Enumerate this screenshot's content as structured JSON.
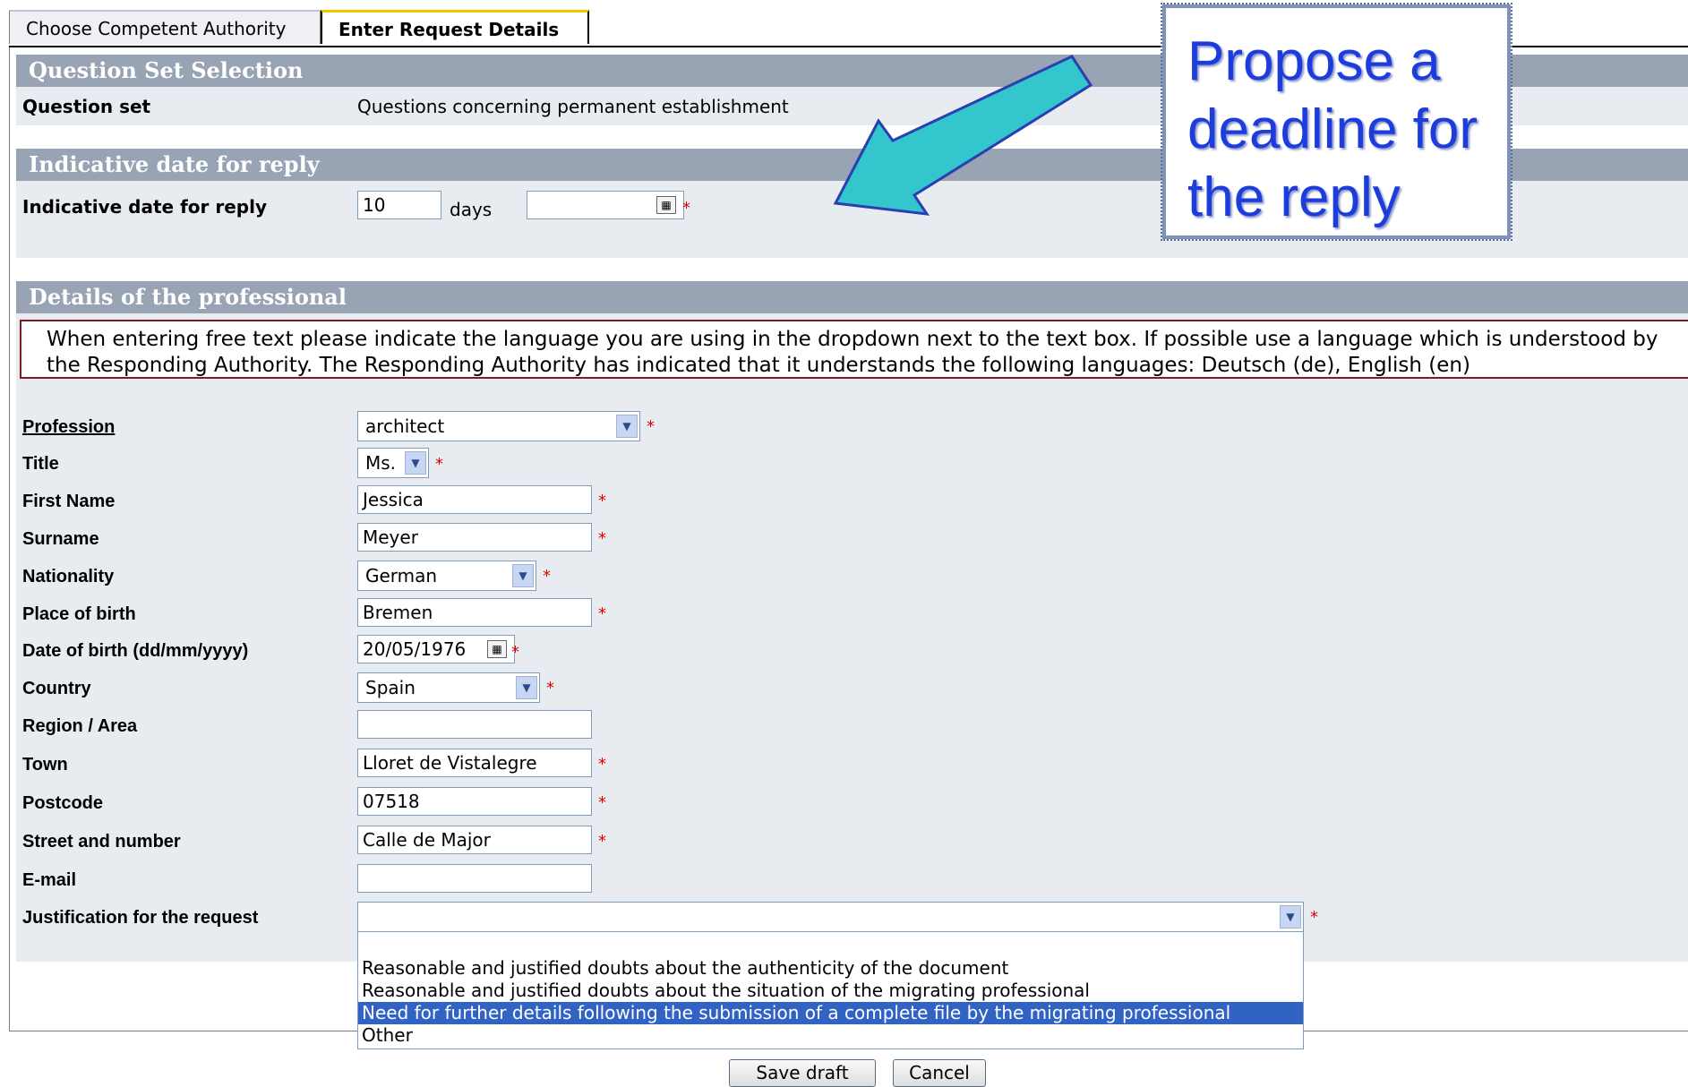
{
  "tabs": [
    {
      "label": "Choose Competent Authority",
      "active": false
    },
    {
      "label": "Enter Request Details",
      "active": true
    }
  ],
  "sections": {
    "question_set": {
      "title": "Question Set Selection",
      "label": "Question set",
      "value": "Questions concerning permanent establishment"
    },
    "indicative": {
      "title": "Indicative date for reply",
      "label": "Indicative date for reply",
      "days_value": "10",
      "days_unit": "days",
      "date_value": ""
    },
    "professional": {
      "title": "Details of the professional",
      "notice": "When entering free text please indicate the language you are using in the dropdown next to the text box. If possible use a language which is understood by the Responding Authority. The Responding Authority has indicated that it understands the following languages: Deutsch (de), English (en)"
    }
  },
  "form": {
    "profession": {
      "label": "Profession ",
      "value": "architect"
    },
    "title": {
      "label": "Title",
      "value": "Ms."
    },
    "first_name": {
      "label": "First Name",
      "value": "Jessica"
    },
    "surname": {
      "label": "Surname",
      "value": "Meyer"
    },
    "nationality": {
      "label": "Nationality",
      "value": "German"
    },
    "place_of_birth": {
      "label": "Place of birth",
      "value": "Bremen"
    },
    "date_of_birth": {
      "label": "Date of birth (dd/mm/yyyy)",
      "value": "20/05/1976"
    },
    "country": {
      "label": "Country",
      "value": "Spain"
    },
    "region": {
      "label": "Region / Area",
      "value": ""
    },
    "town": {
      "label": "Town",
      "value": "Lloret de Vistalegre"
    },
    "postcode": {
      "label": "Postcode",
      "value": "07518"
    },
    "street": {
      "label": "Street and number",
      "value": "Calle de Major"
    },
    "email": {
      "label": "E-mail",
      "value": ""
    },
    "justification": {
      "label": "Justification for the request",
      "value": "",
      "options": [
        "",
        "Reasonable and justified doubts about the authenticity of the document",
        "Reasonable and justified doubts about the situation of the migrating professional",
        "Need for further details following the submission of a complete file by the migrating professional",
        "Other"
      ],
      "highlighted_option": 3
    }
  },
  "buttons": {
    "save": "Save draft",
    "cancel": "Cancel"
  },
  "required_marker": "*",
  "callout": {
    "line1": "Propose a",
    "line2": "deadline for",
    "line3": "the reply",
    "color": "#1d3cdc"
  },
  "arrow": {
    "color": "#33c6cc"
  },
  "colors": {
    "section_header": "#98a4b4",
    "section_body": "#e8ecf1",
    "notice_border": "#7a1f1f",
    "selected_option": "#3163c5",
    "required": "#e00000"
  }
}
